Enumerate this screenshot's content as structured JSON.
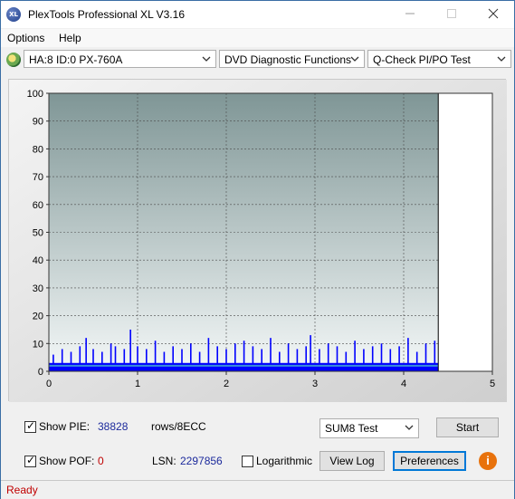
{
  "window": {
    "title": "PlexTools Professional XL V3.16",
    "icon_label": "XL"
  },
  "menu": [
    {
      "label": "Options",
      "underline": "O"
    },
    {
      "label": "Help",
      "underline": "H"
    }
  ],
  "toolbar": {
    "drive": "HA:8 ID:0  PX-760A",
    "function": "DVD Diagnostic Functions",
    "test": "Q-Check PI/PO Test"
  },
  "chart_data": {
    "type": "bar",
    "title": "",
    "xlabel": "",
    "ylabel": "",
    "xlim": [
      0,
      5
    ],
    "ylim": [
      0,
      100
    ],
    "x_ticks": [
      "0",
      "1",
      "2",
      "3",
      "4",
      "5"
    ],
    "y_ticks": [
      "0",
      "10",
      "20",
      "30",
      "40",
      "50",
      "60",
      "70",
      "80",
      "90",
      "100"
    ],
    "grid": true,
    "scan_end_x": 4.39,
    "series": [
      {
        "color": "#0000ff",
        "kind": "pie_bars",
        "x": [
          0.05,
          0.15,
          0.25,
          0.35,
          0.42,
          0.5,
          0.6,
          0.7,
          0.75,
          0.85,
          0.92,
          1.0,
          1.1,
          1.2,
          1.3,
          1.4,
          1.5,
          1.6,
          1.7,
          1.8,
          1.9,
          2.0,
          2.1,
          2.2,
          2.3,
          2.4,
          2.5,
          2.6,
          2.7,
          2.8,
          2.9,
          2.95,
          3.05,
          3.15,
          3.25,
          3.35,
          3.45,
          3.55,
          3.65,
          3.75,
          3.85,
          3.95,
          4.05,
          4.15,
          4.25,
          4.35
        ],
        "values": [
          6,
          8,
          7,
          9,
          12,
          8,
          7,
          10,
          9,
          8,
          15,
          9,
          8,
          11,
          7,
          9,
          8,
          10,
          7,
          12,
          9,
          8,
          10,
          11,
          9,
          8,
          12,
          7,
          10,
          8,
          9,
          13,
          8,
          10,
          9,
          7,
          11,
          8,
          9,
          10,
          8,
          9,
          12,
          7,
          10,
          11
        ]
      },
      {
        "color": "#3a8fd8",
        "kind": "average_line",
        "x": [
          0,
          4.39
        ],
        "values": [
          2,
          2
        ]
      }
    ]
  },
  "controls": {
    "show_pie_label": "Show PIE:",
    "pie_value": "38828",
    "pie_unit": "rows/8ECC",
    "show_pof_label": "Show POF:",
    "pof_value": "0",
    "lsn_label": "LSN:",
    "lsn_value": "2297856",
    "logarithmic_label": "Logarithmic",
    "sum_test": "SUM8 Test",
    "start_label": "Start",
    "view_log_label": "View Log",
    "preferences_label": "Preferences",
    "show_pie_checked": true,
    "show_pof_checked": true,
    "logarithmic_checked": false
  },
  "status": {
    "text": "Ready"
  }
}
